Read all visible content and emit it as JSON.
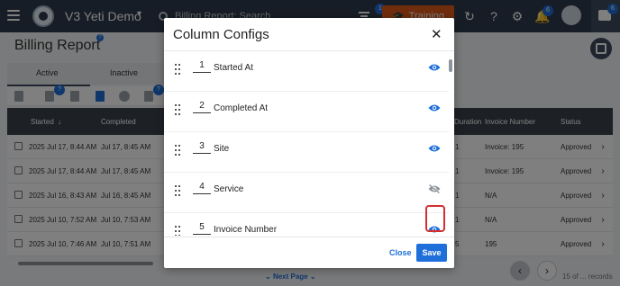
{
  "topbar": {
    "app_title": "V3 Yeti Demo",
    "search_placeholder": "Billing Report: Search",
    "filter_badge": "1",
    "training_label": "Training",
    "notifications_badge": "6",
    "chat_badge": "6"
  },
  "page": {
    "title": "Billing Report",
    "help_badge": "?"
  },
  "tabs": [
    {
      "label": "Active"
    },
    {
      "label": "Inactive"
    }
  ],
  "toolbar": {
    "badge_a": "?",
    "badge_b": "?"
  },
  "table": {
    "headers": {
      "started": "Started",
      "completed": "Completed",
      "duration": "Duration",
      "invoice_number": "Invoice Number",
      "status": "Status"
    },
    "rows": [
      {
        "started": "2025 Jul 17, 8:44 AM",
        "completed": "Jul 17, 8:45 AM",
        "duration": "1",
        "invoice": "Invoice: 195",
        "status": "Approved"
      },
      {
        "started": "2025 Jul 17, 8:44 AM",
        "completed": "Jul 17, 8:45 AM",
        "duration": "1",
        "invoice": "Invoice: 195",
        "status": "Approved"
      },
      {
        "started": "2025 Jul 16, 8:43 AM",
        "completed": "Jul 16, 8:45 AM",
        "duration": "1",
        "invoice": "N/A",
        "status": "Approved"
      },
      {
        "started": "2025 Jul 10, 7:52 AM",
        "completed": "Jul 10, 7:53 AM",
        "duration": "1",
        "invoice": "N/A",
        "status": "Approved"
      },
      {
        "started": "2025 Jul 10, 7:46 AM",
        "completed": "Jul 10, 7:51 AM",
        "duration": "5",
        "invoice": "195",
        "status": "Approved"
      }
    ]
  },
  "pagination": {
    "next_page": "Next Page",
    "records": "15 of ... records"
  },
  "modal": {
    "title": "Column Configs",
    "columns": [
      {
        "order": "1",
        "name": "Started At",
        "visible": true
      },
      {
        "order": "2",
        "name": "Completed At",
        "visible": true
      },
      {
        "order": "3",
        "name": "Site",
        "visible": true
      },
      {
        "order": "4",
        "name": "Service",
        "visible": false
      },
      {
        "order": "5",
        "name": "Invoice Number",
        "visible": true
      }
    ],
    "close_label": "Close",
    "save_label": "Save"
  },
  "colors": {
    "accent": "#1e6fd9",
    "topbar": "#2f3b4c",
    "training": "#e05a1b",
    "highlight": "#d32f2f"
  }
}
